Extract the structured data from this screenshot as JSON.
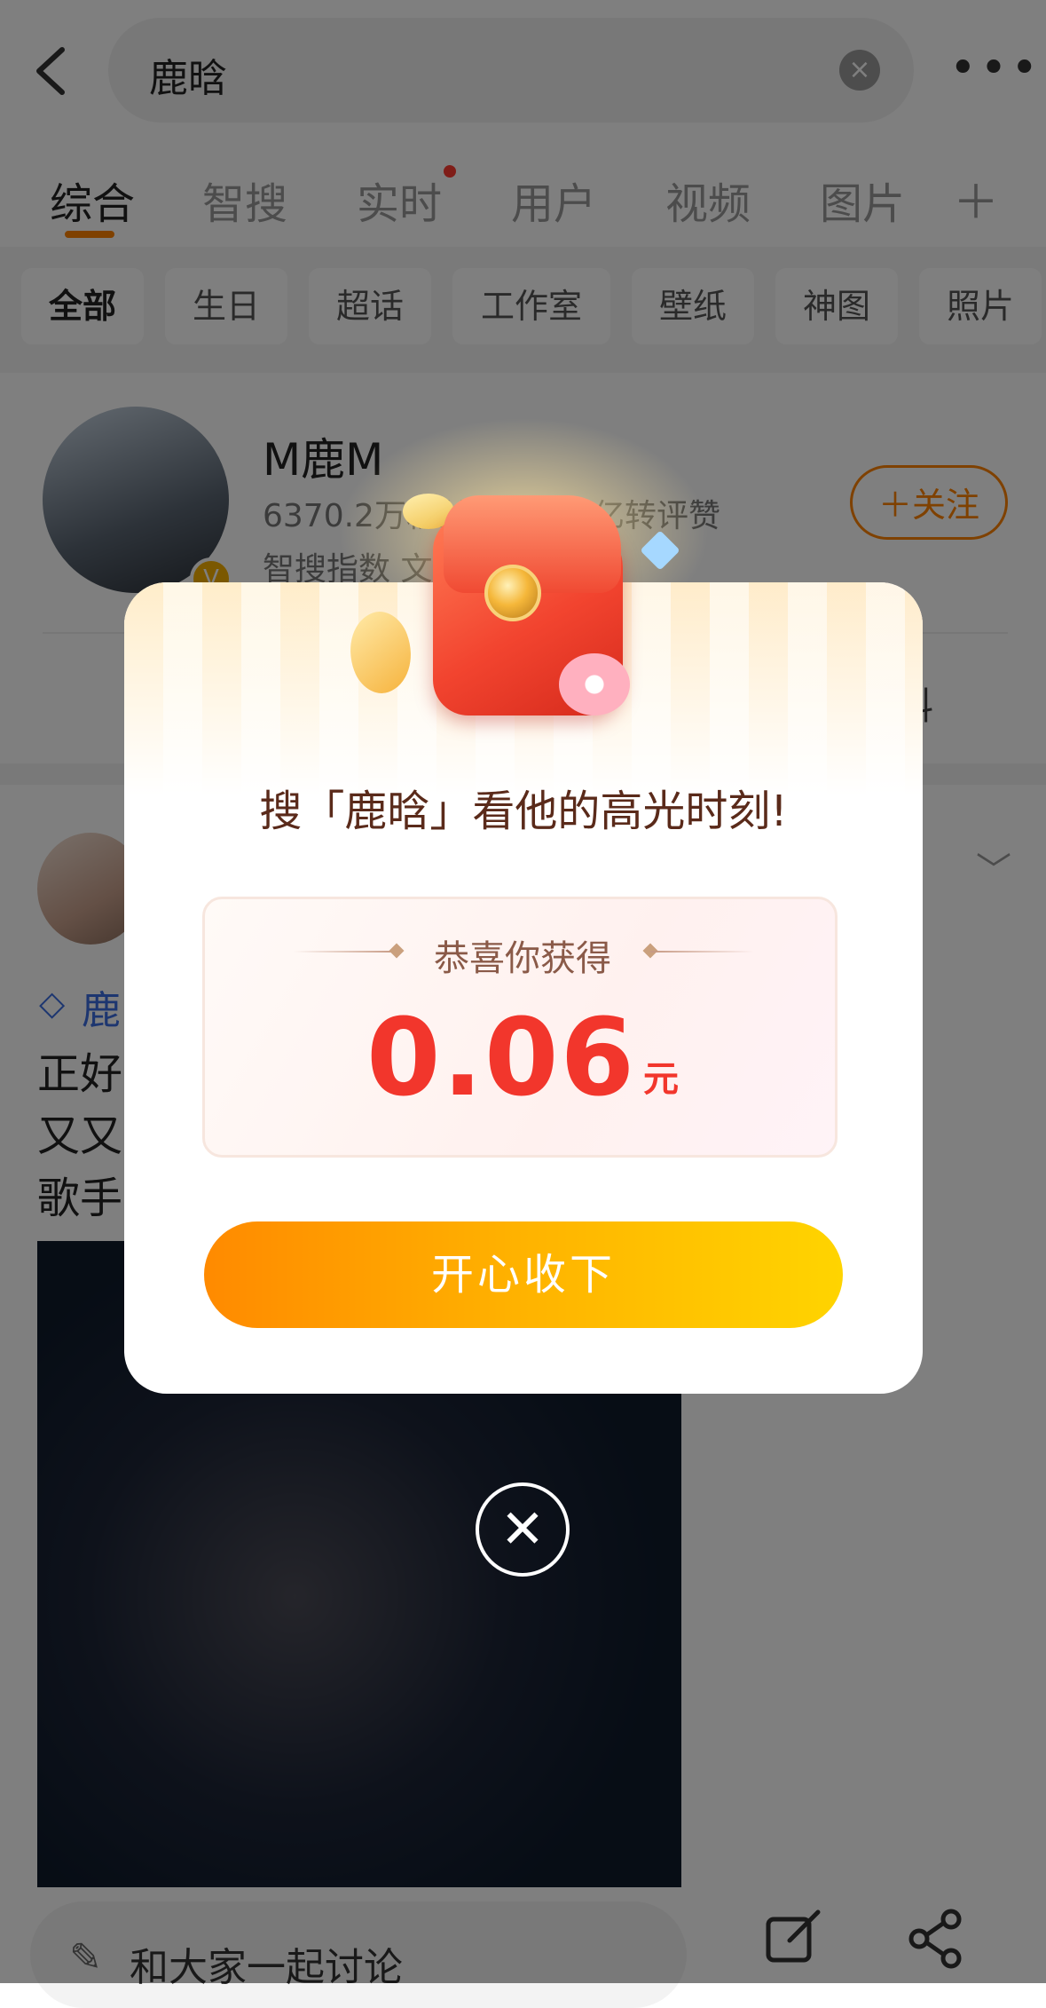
{
  "search": {
    "query": "鹿晗"
  },
  "tabs": [
    {
      "label": "综合",
      "active": true
    },
    {
      "label": "智搜"
    },
    {
      "label": "实时"
    },
    {
      "label": "用户"
    },
    {
      "label": "视频"
    },
    {
      "label": "图片"
    }
  ],
  "chips": [
    "全部",
    "生日",
    "超话",
    "工作室",
    "壁纸",
    "神图",
    "照片"
  ],
  "profile": {
    "name": "M鹿M",
    "stats": "6370.2万粉丝 | 15.63亿转评赞",
    "index": "智搜指数 文娱",
    "follow_label": "＋关注",
    "more_label": "料"
  },
  "post": {
    "author_prefix": "鹿",
    "lines": [
      "正好",
      "又又",
      "歌手"
    ]
  },
  "bottom": {
    "comment_placeholder": "和大家一起讨论"
  },
  "modal": {
    "title": "搜「鹿晗」看他的高光时刻!",
    "prize_label": "恭喜你获得",
    "amount": "0.06",
    "unit": "元",
    "accept_label": "开心收下"
  },
  "colors": {
    "accent": "#ff8200",
    "amount": "#f2362c",
    "button_start": "#ff8a00",
    "button_end": "#ffd400"
  }
}
